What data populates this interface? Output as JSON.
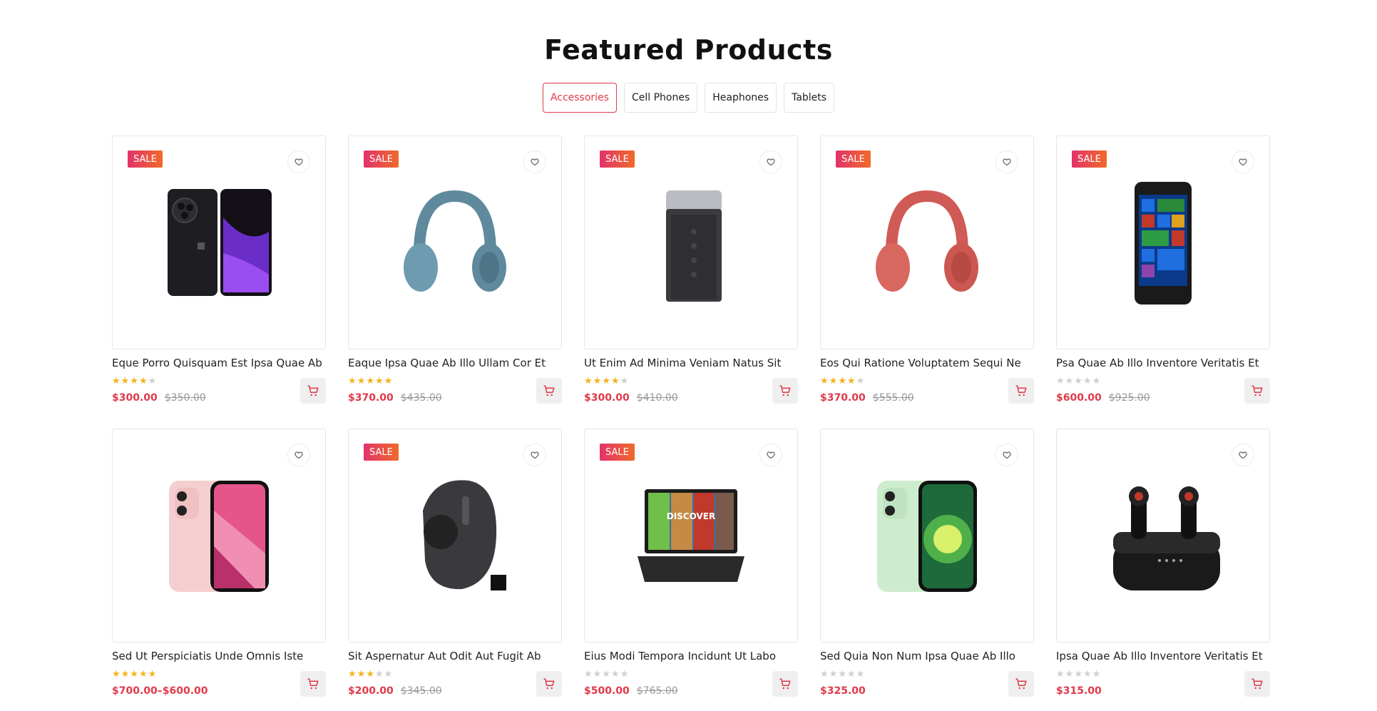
{
  "section": {
    "title": "Featured Products"
  },
  "tabs": [
    {
      "label": "Accessories",
      "active": true
    },
    {
      "label": "Cell Phones",
      "active": false
    },
    {
      "label": "Heaphones",
      "active": false
    },
    {
      "label": "Tablets",
      "active": false
    }
  ],
  "products": [
    {
      "name": "Eque Porro Quisquam Est Ipsa Quae Ab",
      "sale": "SALE",
      "rating": 4,
      "price": "$300.00",
      "old_price": "$350.00",
      "image": "smartphone-dark"
    },
    {
      "name": "Eaque Ipsa Quae Ab Illo Ullam Cor Et",
      "sale": "SALE",
      "rating": 5,
      "price": "$370.00",
      "old_price": "$435.00",
      "image": "headphones-blue"
    },
    {
      "name": "Ut Enim Ad Minima Veniam Natus Sit",
      "sale": "SALE",
      "rating": 4,
      "price": "$300.00",
      "old_price": "$410.00",
      "image": "speaker"
    },
    {
      "name": "Eos Qui Ratione Voluptatem Sequi Ne",
      "sale": "SALE",
      "rating": 4,
      "price": "$370.00",
      "old_price": "$555.00",
      "image": "headphones-red"
    },
    {
      "name": "Psa Quae Ab Illo Inventore Veritatis Et",
      "sale": "SALE",
      "rating": 0,
      "price": "$600.00",
      "old_price": "$925.00",
      "image": "windows-phone"
    },
    {
      "name": "Sed Ut Perspiciatis Unde Omnis Iste",
      "sale": "",
      "rating": 5,
      "price": "$700.00–$600.00",
      "old_price": "",
      "image": "iphone-pink"
    },
    {
      "name": "Sit Aspernatur Aut Odit Aut Fugit Ab",
      "sale": "SALE",
      "rating": 3,
      "price": "$200.00",
      "old_price": "$345.00",
      "image": "trackball-mouse"
    },
    {
      "name": "Eius Modi Tempora Incidunt Ut Labo",
      "sale": "SALE",
      "rating": 0,
      "price": "$500.00",
      "old_price": "$765.00",
      "image": "laptop",
      "image_text": "DISCOVER"
    },
    {
      "name": "Sed Quia Non Num Ipsa Quae Ab Illo",
      "sale": "",
      "rating": 0,
      "price": "$325.00",
      "old_price": "",
      "image": "iphone-green"
    },
    {
      "name": "Ipsa Quae Ab Illo Inventore Veritatis Et",
      "sale": "",
      "rating": 0,
      "price": "$315.00",
      "old_price": "",
      "image": "earbuds"
    }
  ],
  "icons": {
    "wishlist": "heart-icon",
    "cart": "cart-icon",
    "rating": "star-icon"
  },
  "colors": {
    "accent": "#e03a4a",
    "star": "#f5b21a",
    "sale_from": "#e2336b",
    "sale_to": "#f06a2a"
  }
}
